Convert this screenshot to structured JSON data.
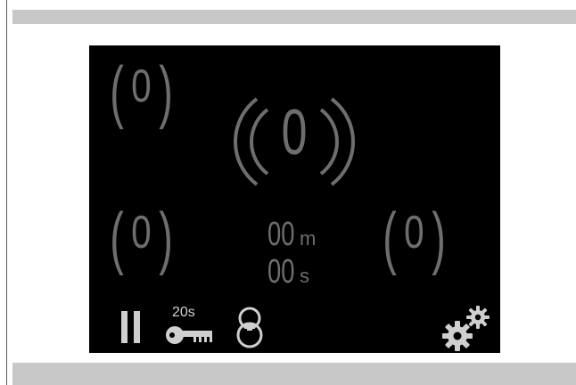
{
  "counters": {
    "top_left": "0",
    "center": "0",
    "bottom_left": "0",
    "bottom_right": "0"
  },
  "timer": {
    "minutes": "00",
    "minutes_unit": "m",
    "seconds": "00",
    "seconds_unit": "s"
  },
  "toolbar": {
    "key_delay_label": "20s",
    "icons": [
      "pause-icon",
      "key-icon",
      "lock-icon",
      "settings-gears-icon"
    ]
  },
  "colors": {
    "screen_background": "#000000",
    "counter_text": "#6e6e6e",
    "toolbar_icons": "#cfcfcf",
    "frame_bands": "#c8c8c8"
  }
}
